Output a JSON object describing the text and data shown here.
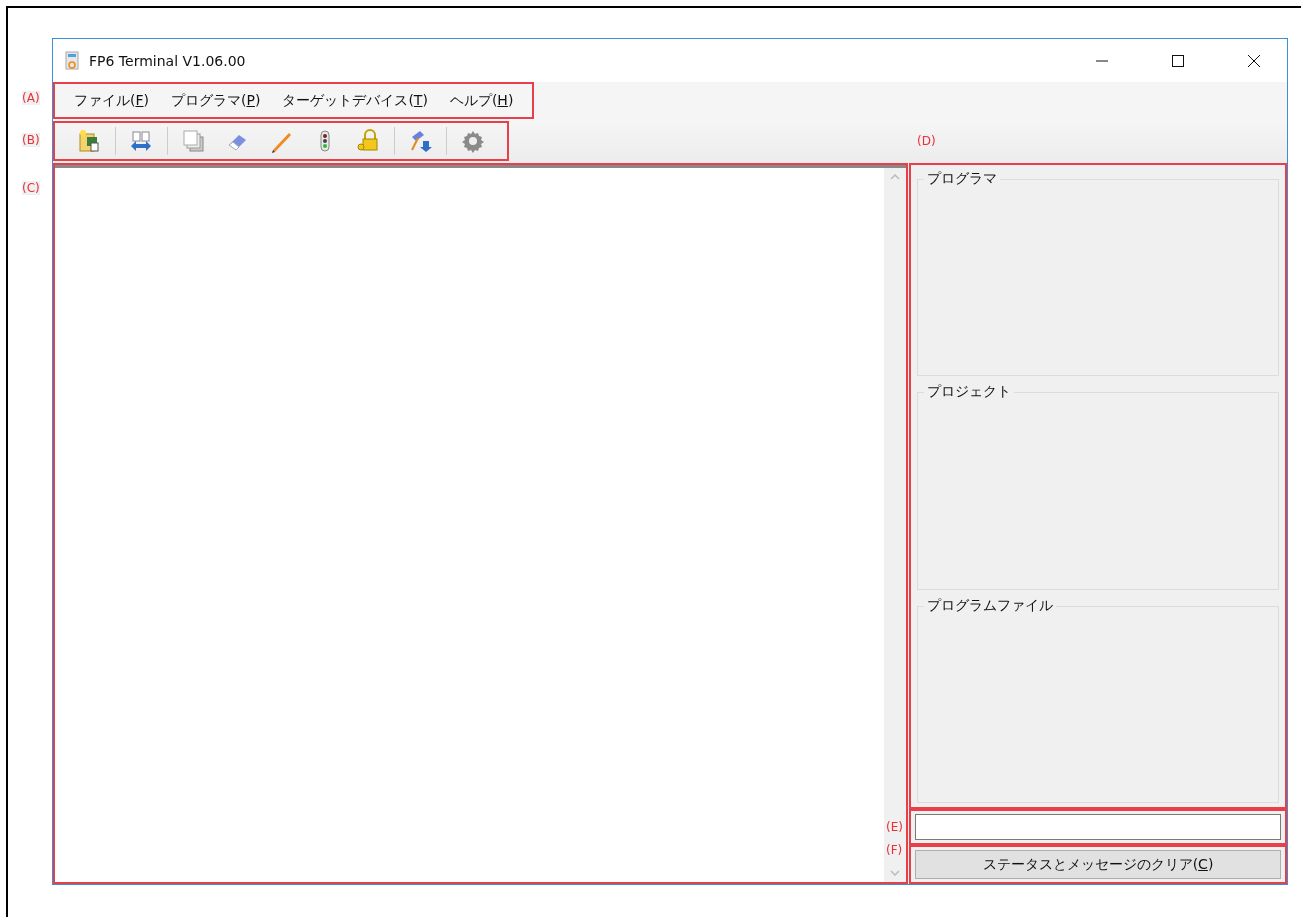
{
  "window": {
    "title": "FP6 Terminal V1.06.00"
  },
  "menu": [
    {
      "before": "ファイル(",
      "key": "F",
      "after": ")"
    },
    {
      "before": "プログラマ(",
      "key": "P",
      "after": ")"
    },
    {
      "before": "ターゲットデバイス(",
      "key": "T",
      "after": ")"
    },
    {
      "before": "ヘルプ(",
      "key": "H",
      "after": ")"
    }
  ],
  "groups": [
    "プログラマ",
    "プロジェクト",
    "プログラムファイル"
  ],
  "clear_button": {
    "before": "ステータスとメッセージのクリア(",
    "key": "C",
    "after": ")"
  },
  "annotations": {
    "menu": "(A)",
    "toolbar": "(B)",
    "log": "(C)",
    "panel": "(D)",
    "status": "(E)",
    "button": "(F)"
  }
}
